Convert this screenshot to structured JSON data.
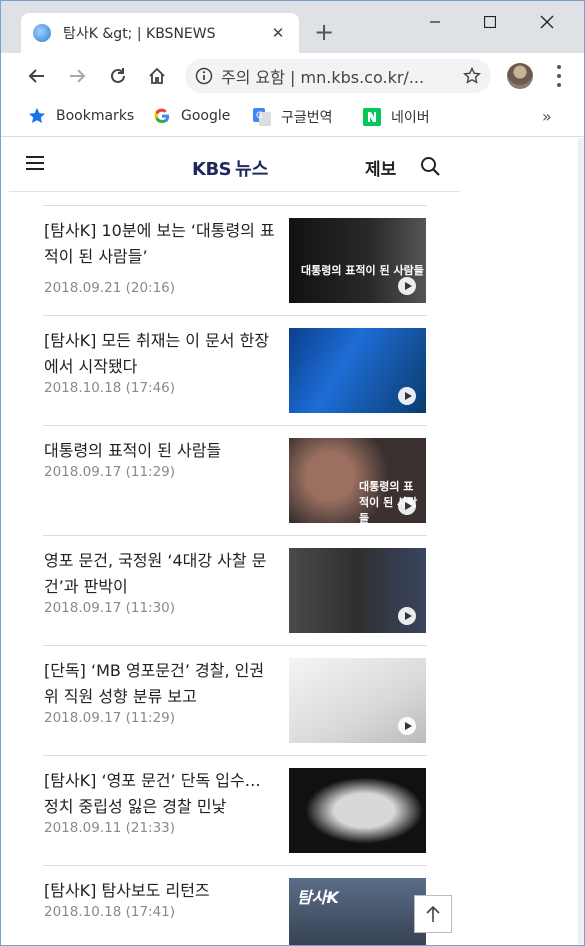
{
  "browser": {
    "tab_title": "탐사K &gt; | KBSNEWS",
    "tab_close": "✕",
    "new_tab": "+",
    "controls": {
      "minimize": "—",
      "maximize": "☐",
      "close": "✕"
    },
    "address": "주의 요함 | mn.kbs.co.kr/...",
    "bookmarks": [
      {
        "label": "Bookmarks",
        "icon": "star-icon"
      },
      {
        "label": "Google",
        "icon": "google-icon"
      },
      {
        "label": "구글번역",
        "icon": "translate-icon"
      },
      {
        "label": "네이버",
        "icon": "naver-icon"
      }
    ],
    "bookmarks_more": "»"
  },
  "site": {
    "logo_kbs": "KBS",
    "logo_news": "뉴스",
    "report": "제보"
  },
  "news": [
    {
      "title": "[탐사K] 10분에 보는 ‘대통령의 표적이 된 사람들’",
      "date": "2018.09.21 (20:16)",
      "thumb_caption": "대통령의 표적이 된 사람들"
    },
    {
      "title": "[탐사K] 모든 취재는 이 문서 한장에서 시작됐다",
      "date": "2018.10.18 (17:46)",
      "thumb_caption": ""
    },
    {
      "title": "대통령의 표적이 된 사람들",
      "date": "2018.09.17 (11:29)",
      "thumb_caption": "대통령의 표적이 된 사람들"
    },
    {
      "title": "영포 문건, 국정원 ‘4대강 사찰 문건’과 판박이",
      "date": "2018.09.17 (11:30)",
      "thumb_caption": ""
    },
    {
      "title": "[단독] ‘MB 영포문건’ 경찰, 인권위 직원 성향 분류 보고",
      "date": "2018.09.17 (11:29)",
      "thumb_caption": ""
    },
    {
      "title": "[탐사K] ‘영포 문건’ 단독 입수… 정치 중립성 잃은 경찰 민낯",
      "date": "2018.09.11 (21:33)",
      "thumb_caption": ""
    },
    {
      "title": "[탐사K] 탐사보도 리턴즈",
      "date": "2018.10.18 (17:41)",
      "thumb_caption": "탐사K"
    }
  ],
  "colors": {
    "brand": "#1f2a5c",
    "date": "#8a8a8a",
    "accent_blue": "#1a73e8"
  }
}
